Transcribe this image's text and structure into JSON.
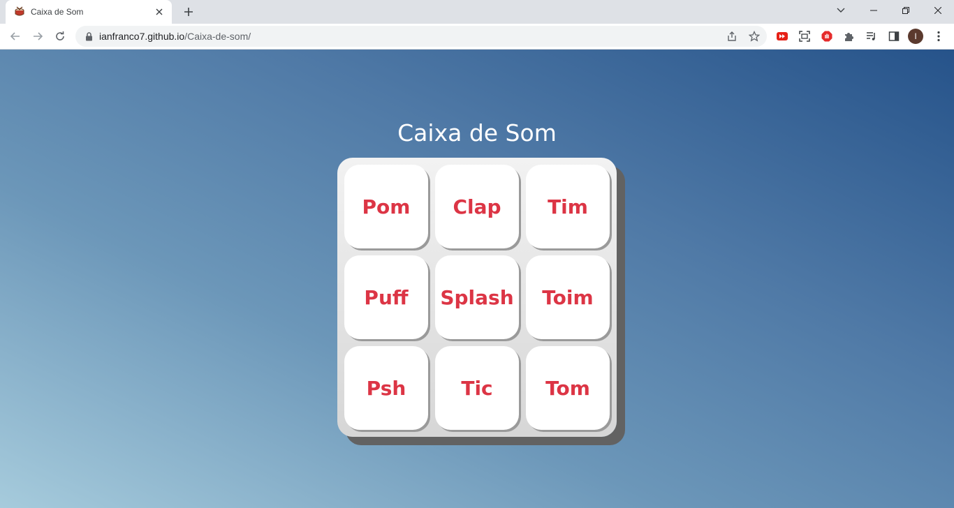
{
  "browser": {
    "tab": {
      "title": "Caixa de Som",
      "favicon": "drum-icon"
    },
    "url": {
      "host": "ianfranco7.github.io",
      "path": "/Caixa-de-som/"
    },
    "profile_initial": "I",
    "icons": {
      "back": "arrow-left-icon",
      "forward": "arrow-right-icon",
      "reload": "reload-icon",
      "share": "share-icon",
      "bookmark": "star-icon",
      "extensions": "puzzle-icon",
      "media": "media-queue-icon",
      "side_panel": "side-panel-icon",
      "menu": "kebab-menu-icon"
    }
  },
  "page": {
    "title": "Caixa de Som",
    "keys": [
      "Pom",
      "Clap",
      "Tim",
      "Puff",
      "Splash",
      "Toim",
      "Psh",
      "Tic",
      "Tom"
    ]
  },
  "colors": {
    "key_text": "#dc3545",
    "title_text": "#ffffff",
    "background_gradient": [
      "#a6cbdc",
      "#26538a"
    ],
    "keypad_shadow": "#626262"
  }
}
